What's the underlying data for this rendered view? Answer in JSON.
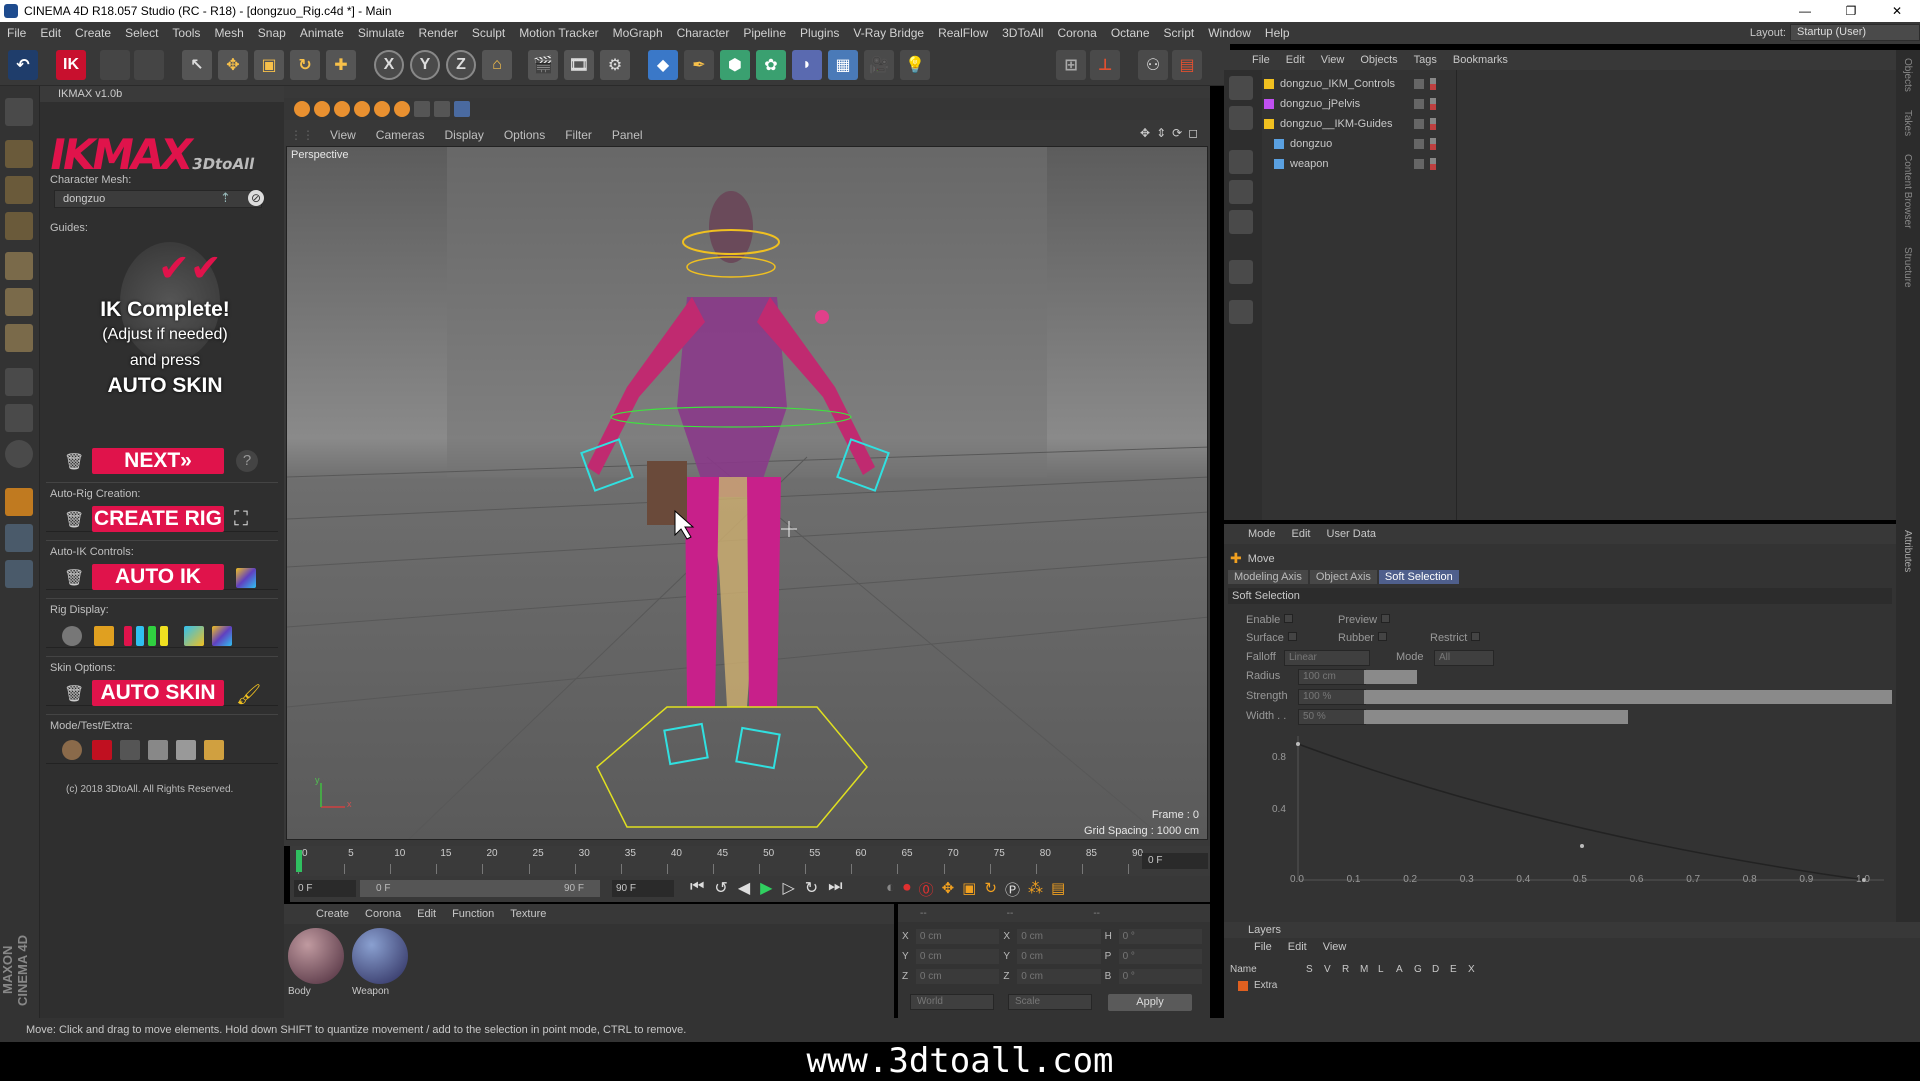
{
  "window": {
    "title": "CINEMA 4D R18.057 Studio (RC - R18) - [dongzuo_Rig.c4d *] - Main"
  },
  "menu": [
    "File",
    "Edit",
    "Create",
    "Select",
    "Tools",
    "Mesh",
    "Snap",
    "Animate",
    "Simulate",
    "Render",
    "Sculpt",
    "Motion Tracker",
    "MoGraph",
    "Character",
    "Pipeline",
    "Plugins",
    "V-Ray Bridge",
    "RealFlow",
    "3DToAll",
    "Corona",
    "Octane",
    "Script",
    "Window",
    "Help"
  ],
  "layout": {
    "label": "Layout:",
    "value": "Startup (User)"
  },
  "toolbar": {
    "axis_x": "X",
    "axis_y": "Y",
    "axis_z": "Z"
  },
  "ikmax": {
    "header": "IKMAX v1.0b",
    "logo": "IKMAX",
    "logo_sub": "3DtoAll",
    "char_mesh_label": "Character Mesh:",
    "char_mesh_value": "dongzuo",
    "guides_label": "Guides:",
    "msg1": "IK Complete!",
    "msg2": "(Adjust if needed)",
    "msg3": "and press",
    "msg4": "AUTO SKIN",
    "next": "NEXT»",
    "help": "?",
    "autorig_label": "Auto-Rig Creation:",
    "create_rig": "CREATE RIG",
    "autoik_label": "Auto-IK Controls:",
    "auto_ik": "AUTO IK",
    "rigdisplay_label": "Rig Display:",
    "skin_label": "Skin Options:",
    "auto_skin": "AUTO SKIN",
    "mode_label": "Mode/Test/Extra:",
    "copyright": "(c) 2018 3DtoAll. All Rights Reserved."
  },
  "viewport": {
    "menu": [
      "View",
      "Cameras",
      "Display",
      "Options",
      "Filter",
      "Panel"
    ],
    "camera": "Perspective",
    "frame": "Frame : 0",
    "grid": "Grid Spacing : 1000 cm",
    "axis_x": "x",
    "axis_y": "y"
  },
  "timeline": {
    "ticks": [
      "0",
      "5",
      "10",
      "15",
      "20",
      "25",
      "30",
      "35",
      "40",
      "45",
      "50",
      "55",
      "60",
      "65",
      "70",
      "75",
      "80",
      "85",
      "90"
    ],
    "current": "0 F",
    "start": "0 F",
    "range_start": "0 F",
    "range_end": "90 F",
    "end": "90 F"
  },
  "material": {
    "menu": [
      "Create",
      "Corona",
      "Edit",
      "Function",
      "Texture"
    ],
    "items": [
      {
        "name": "Body"
      },
      {
        "name": "Weapon"
      }
    ]
  },
  "coords": {
    "header": [
      "--",
      "--",
      "--"
    ],
    "rows": [
      {
        "a": "X",
        "av": "0 cm",
        "b": "X",
        "bv": "0 cm",
        "c": "H",
        "cv": "0 °"
      },
      {
        "a": "Y",
        "av": "0 cm",
        "b": "Y",
        "bv": "0 cm",
        "c": "P",
        "cv": "0 °"
      },
      {
        "a": "Z",
        "av": "0 cm",
        "b": "Z",
        "bv": "0 cm",
        "c": "B",
        "cv": "0 °"
      }
    ],
    "world": "World",
    "scale": "Scale",
    "apply": "Apply"
  },
  "objects": {
    "menu": [
      "File",
      "Edit",
      "View",
      "Objects",
      "Tags",
      "Bookmarks"
    ],
    "items": [
      {
        "name": "dongzuo_IKM_Controls"
      },
      {
        "name": "dongzuo_jPelvis"
      },
      {
        "name": "dongzuo__IKM-Guides"
      },
      {
        "name": "dongzuo"
      },
      {
        "name": "weapon"
      }
    ]
  },
  "attributes": {
    "menu": [
      "Mode",
      "Edit",
      "User Data"
    ],
    "tool": "Move",
    "tabs": [
      "Modeling Axis",
      "Object Axis",
      "Soft Selection"
    ],
    "section": "Soft Selection",
    "enable": "Enable",
    "preview": "Preview",
    "surface": "Surface",
    "rubber": "Rubber",
    "restrict": "Restrict",
    "falloff_label": "Falloff",
    "falloff_value": "Linear",
    "mode_label": "Mode",
    "mode_value": "All",
    "radius_label": "Radius",
    "radius_value": "100 cm",
    "radius_pct": 0.1,
    "strength_label": "Strength",
    "strength_value": "100 %",
    "strength_pct": 1.0,
    "width_label": "Width . .",
    "width_value": "50 %",
    "width_pct": 0.5,
    "graph_y": [
      "0.8",
      "0.4"
    ],
    "graph_x": [
      "0.0",
      "0.1",
      "0.2",
      "0.3",
      "0.4",
      "0.5",
      "0.6",
      "0.7",
      "0.8",
      "0.9",
      "1.0"
    ]
  },
  "layers": {
    "title": "Layers",
    "menu": [
      "File",
      "Edit",
      "View"
    ],
    "col_name": "Name",
    "cols": [
      "S",
      "V",
      "R",
      "M",
      "L",
      "A",
      "G",
      "D",
      "E",
      "X"
    ],
    "row": "Extra"
  },
  "right_tabs": [
    "Objects",
    "Takes",
    "Content Browser",
    "Structure"
  ],
  "attr_tab": "Attributes",
  "status": "Move: Click and drag to move elements. Hold down SHIFT to quantize movement / add to the selection in point mode, CTRL to remove.",
  "brand": "MAXON CINEMA 4D",
  "watermark": "www.3dtoall.com",
  "colors": {
    "accent": "#e0134b",
    "panel": "#333333",
    "viewport": "#6a6a6a",
    "selected_tab": "#4f5f8c"
  }
}
